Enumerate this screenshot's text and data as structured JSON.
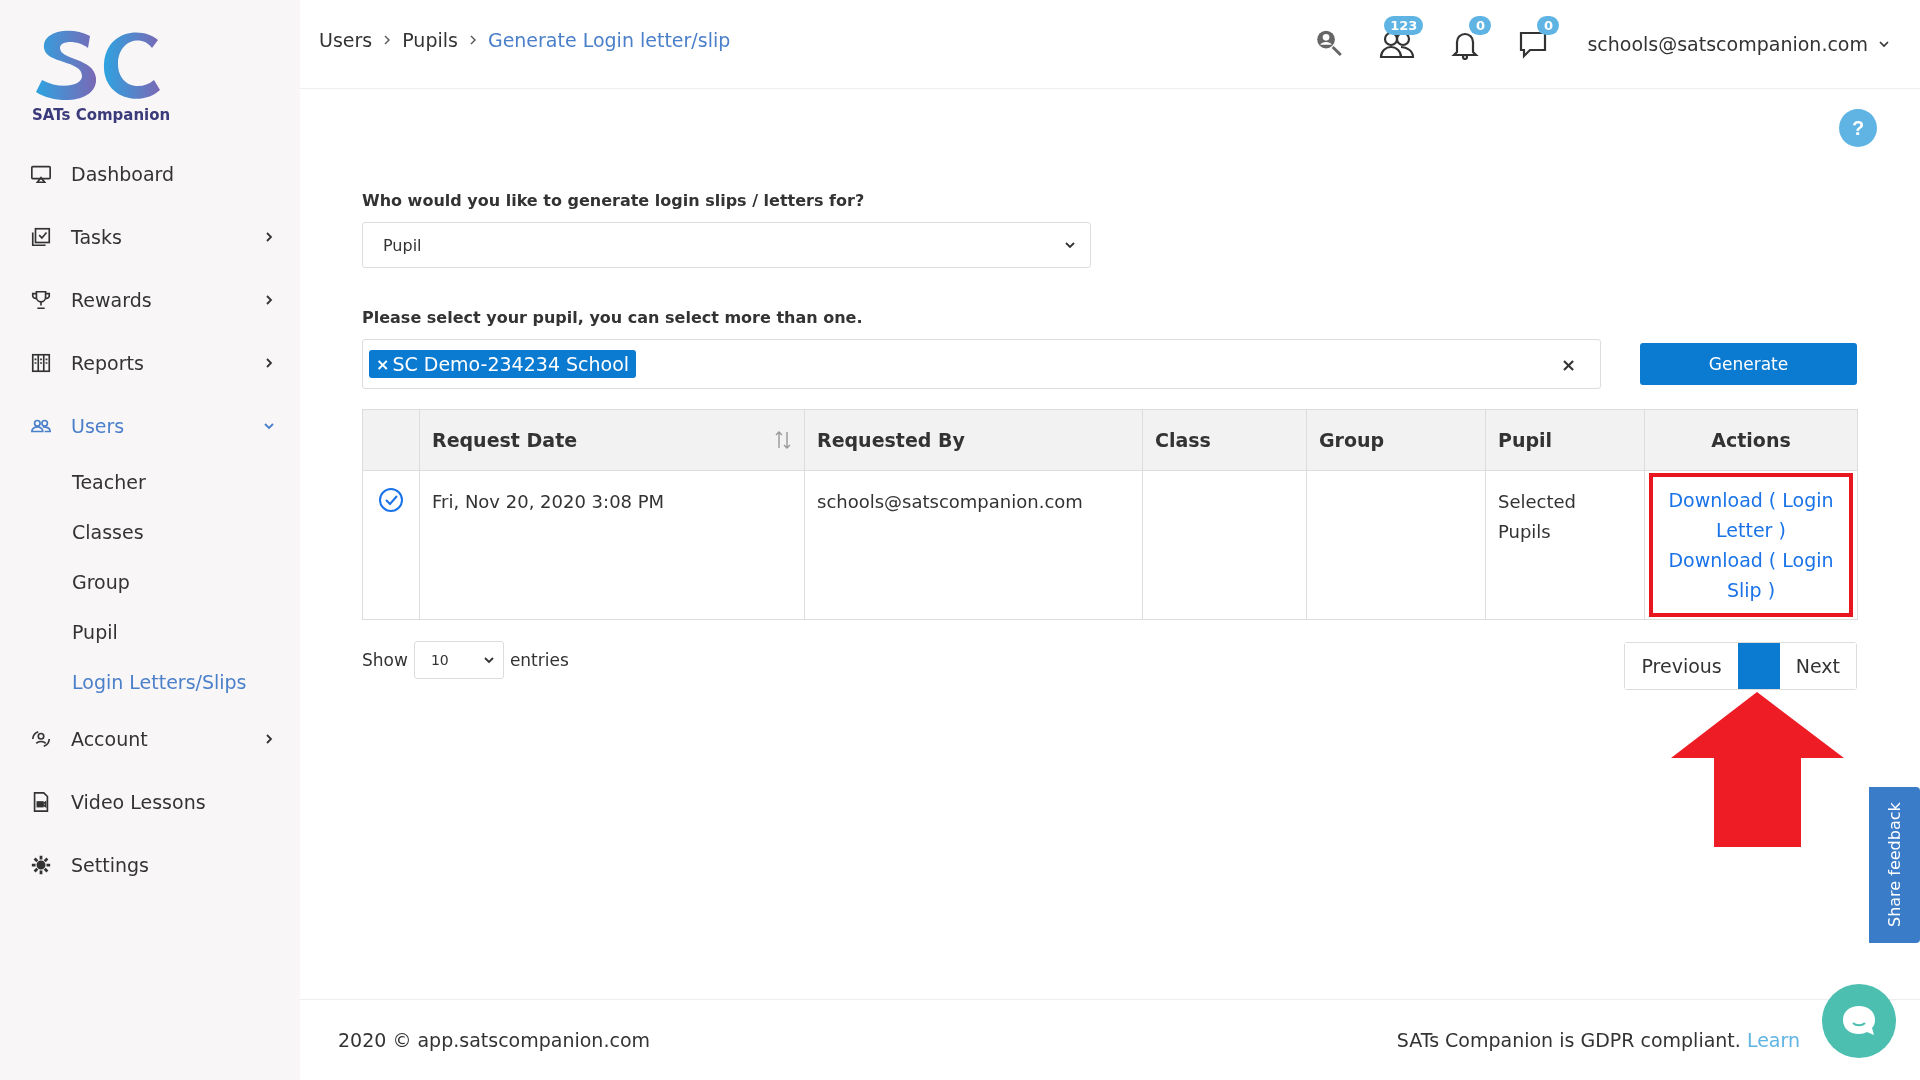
{
  "logo": {
    "text": "SATs Companion"
  },
  "sidebar": {
    "items": [
      {
        "label": "Dashboard",
        "kind": "link",
        "selected": false
      },
      {
        "label": "Tasks",
        "kind": "group",
        "expanded": false,
        "selected": false
      },
      {
        "label": "Rewards",
        "kind": "group",
        "expanded": false,
        "selected": false
      },
      {
        "label": "Reports",
        "kind": "group",
        "expanded": false,
        "selected": false
      },
      {
        "label": "Users",
        "kind": "group",
        "expanded": true,
        "selected": true,
        "children": [
          {
            "label": "Teacher",
            "selected": false
          },
          {
            "label": "Classes",
            "selected": false
          },
          {
            "label": "Group",
            "selected": false
          },
          {
            "label": "Pupil",
            "selected": false
          },
          {
            "label": "Login Letters/Slips",
            "selected": true
          }
        ]
      },
      {
        "label": "Account",
        "kind": "group",
        "expanded": false,
        "selected": false
      },
      {
        "label": "Video Lessons",
        "kind": "link",
        "selected": false
      },
      {
        "label": "Settings",
        "kind": "link",
        "selected": false
      }
    ]
  },
  "breadcrumbs": [
    {
      "label": "Users",
      "current": false
    },
    {
      "label": "Pupils",
      "current": false
    },
    {
      "label": "Generate Login letter/slip",
      "current": true
    }
  ],
  "header": {
    "badges": [
      "123",
      "0",
      "0"
    ],
    "user": "schools@satscompanion.com"
  },
  "help": "?",
  "form": {
    "audience_label": "Who would you like to generate login slips / letters for?",
    "audience_value": "Pupil",
    "pupil_label": "Please select your pupil, you can select more than one.",
    "tags": [
      {
        "label": "SC Demo-234234 School",
        "remove": "×"
      }
    ],
    "clear": "×",
    "generate": "Generate"
  },
  "table": {
    "columns": [
      {
        "label": "Request Date",
        "sortable": true
      },
      {
        "label": "Requested By",
        "sortable": false
      },
      {
        "label": "Class",
        "sortable": false
      },
      {
        "label": "Group",
        "sortable": false
      },
      {
        "label": "Pupil",
        "sortable": false
      },
      {
        "label": "Actions",
        "sortable": false
      }
    ],
    "rows": [
      {
        "checked": true,
        "request_date": "Fri, Nov 20, 2020 3:08 PM",
        "requested_by": "schools@satscompanion.com",
        "pupil": "Selected Pupils",
        "actions": [
          "Download ( Login Letter )",
          "Download ( Login Slip )"
        ]
      }
    ]
  },
  "paging": {
    "show": "Show",
    "page_size": "10",
    "entries": "entries",
    "previous": "Previous",
    "next": "Next"
  },
  "footer": {
    "copyright": "2020 © app.satscompanion.com",
    "gdpr": "SATs Companion is GDPR compliant.",
    "link": "Learn"
  },
  "feedback": "Share feedback"
}
